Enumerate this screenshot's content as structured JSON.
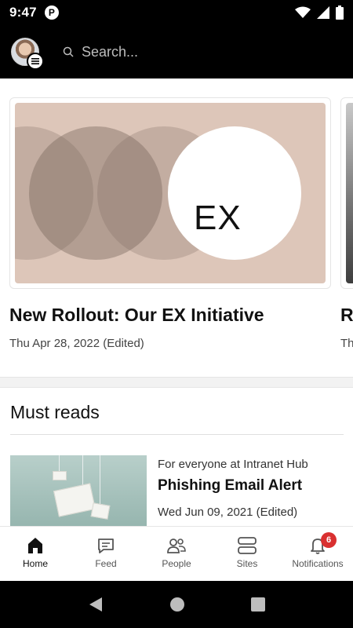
{
  "status_bar": {
    "time": "9:47",
    "app_icon_letter": "P"
  },
  "app_bar": {
    "search_placeholder": "Search..."
  },
  "news_card": {
    "image_text": "EX",
    "title": "New Rollout: Our EX Initiative",
    "date": "Thu Apr 28, 2022 (Edited)"
  },
  "next_card_peek": {
    "title_fragment": "R",
    "date_fragment": "Th"
  },
  "must_reads": {
    "heading": "Must reads",
    "articles": [
      {
        "audience": "For everyone at Intranet Hub",
        "title": "Phishing Email Alert",
        "date": "Wed Jun 09, 2021 (Edited)"
      }
    ]
  },
  "bottom_nav": {
    "items": [
      {
        "label": "Home",
        "icon": "home-icon",
        "active": true
      },
      {
        "label": "Feed",
        "icon": "chat-icon"
      },
      {
        "label": "People",
        "icon": "people-icon"
      },
      {
        "label": "Sites",
        "icon": "sites-icon"
      },
      {
        "label": "Notifications",
        "icon": "bell-icon",
        "badge": "6"
      }
    ]
  },
  "colors": {
    "badge": "#d93030",
    "hero_background": "#ddc6b9"
  }
}
